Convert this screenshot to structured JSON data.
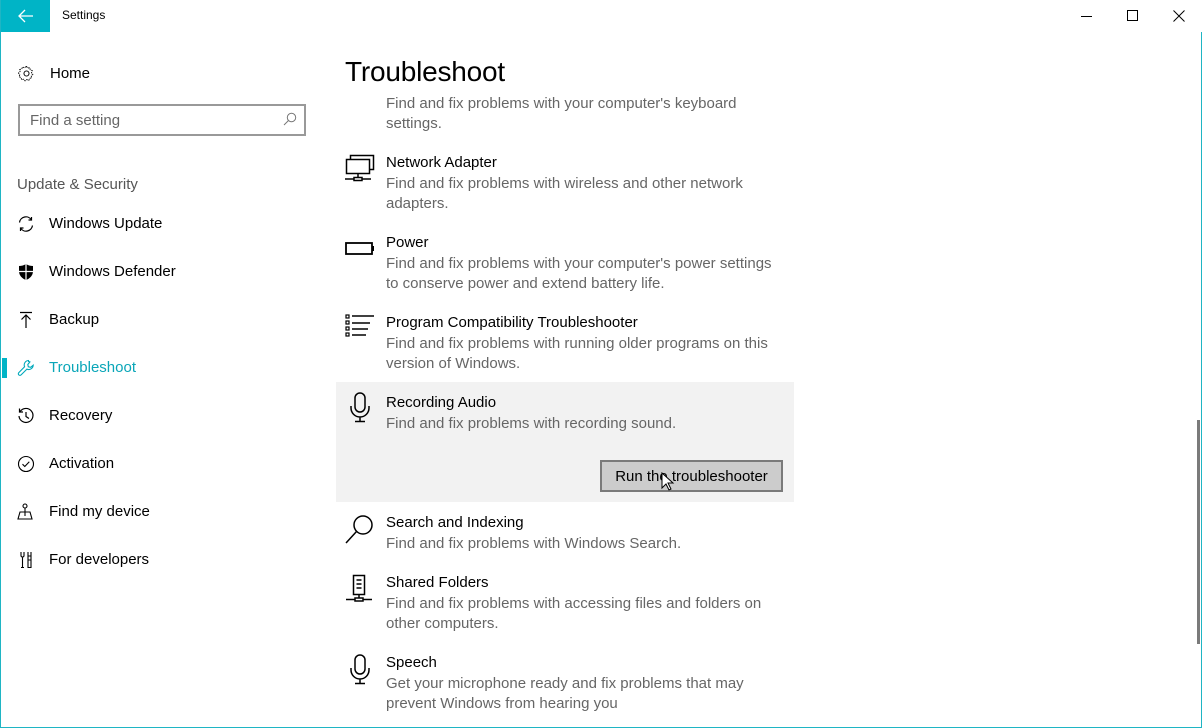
{
  "window": {
    "title": "Settings",
    "accent_color": "#00b4c6",
    "controls": {
      "minimize": "minimize-icon",
      "maximize": "maximize-icon",
      "close": "close-icon"
    },
    "back_icon": "back-arrow-icon"
  },
  "sidebar": {
    "home": {
      "label": "Home",
      "icon": "gear-icon"
    },
    "search": {
      "placeholder": "Find a setting",
      "value": "",
      "icon": "search-icon"
    },
    "section_heading": "Update & Security",
    "items": [
      {
        "label": "Windows Update",
        "icon": "sync-icon",
        "active": false
      },
      {
        "label": "Windows Defender",
        "icon": "shield-icon",
        "active": false
      },
      {
        "label": "Backup",
        "icon": "upload-arrow-icon",
        "active": false
      },
      {
        "label": "Troubleshoot",
        "icon": "wrench-icon",
        "active": true
      },
      {
        "label": "Recovery",
        "icon": "history-icon",
        "active": false
      },
      {
        "label": "Activation",
        "icon": "check-circle-icon",
        "active": false
      },
      {
        "label": "Find my device",
        "icon": "person-pin-icon",
        "active": false
      },
      {
        "label": "For developers",
        "icon": "developer-tools-icon",
        "active": false
      }
    ]
  },
  "main": {
    "title": "Troubleshoot",
    "partial_item": {
      "description": "Find and fix problems with your computer's keyboard settings."
    },
    "items": [
      {
        "name": "Network Adapter",
        "description": "Find and fix problems with wireless and other network adapters.",
        "icon": "network-adapter-icon"
      },
      {
        "name": "Power",
        "description": "Find and fix problems with your computer's power settings to conserve power and extend battery life.",
        "icon": "battery-icon"
      },
      {
        "name": "Program Compatibility Troubleshooter",
        "description": "Find and fix problems with running older programs on this version of Windows.",
        "icon": "list-icon"
      },
      {
        "name": "Recording Audio",
        "description": "Find and fix problems with recording sound.",
        "icon": "microphone-icon",
        "selected": true,
        "action_label": "Run the troubleshooter"
      },
      {
        "name": "Search and Indexing",
        "description": "Find and fix problems with Windows Search.",
        "icon": "search-icon"
      },
      {
        "name": "Shared Folders",
        "description": "Find and fix problems with accessing files and folders on other computers.",
        "icon": "shared-folders-icon"
      },
      {
        "name": "Speech",
        "description": "Get your microphone ready and fix problems that may prevent Windows from hearing you",
        "icon": "microphone-icon"
      }
    ]
  }
}
